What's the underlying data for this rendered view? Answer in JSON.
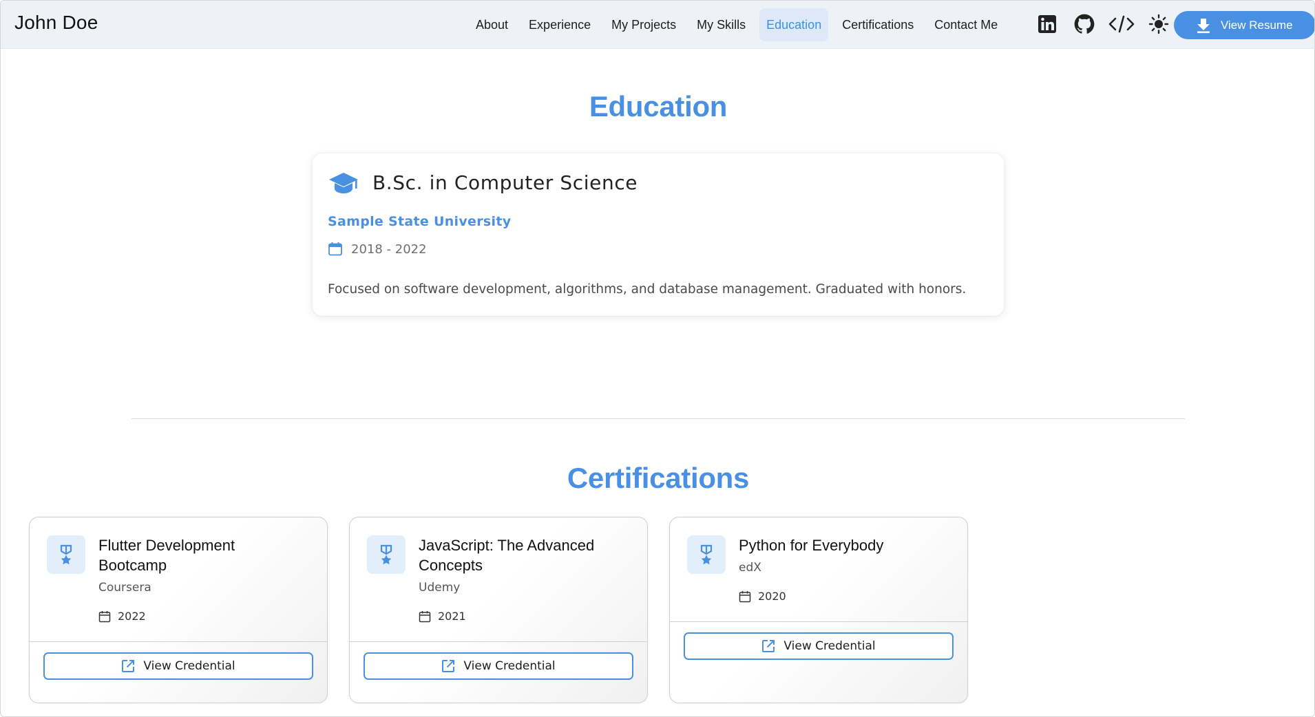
{
  "header": {
    "brand": "John Doe",
    "nav": [
      {
        "label": "About",
        "active": false
      },
      {
        "label": "Experience",
        "active": false
      },
      {
        "label": "My Projects",
        "active": false
      },
      {
        "label": "My Skills",
        "active": false
      },
      {
        "label": "Education",
        "active": true
      },
      {
        "label": "Certifications",
        "active": false
      },
      {
        "label": "Contact Me",
        "active": false
      }
    ],
    "icons": [
      "linkedin-icon",
      "github-icon",
      "code-icon",
      "sun-icon"
    ],
    "resume_button": "View Resume"
  },
  "education": {
    "title": "Education",
    "degree": "B.Sc. in Computer Science",
    "school": "Sample State University",
    "dates": "2018 - 2022",
    "description": "Focused on software development, algorithms, and database management. Graduated with honors."
  },
  "certifications": {
    "title": "Certifications",
    "items": [
      {
        "name": "Flutter Development Bootcamp",
        "issuer": "Coursera",
        "year": "2022",
        "button": "View Credential"
      },
      {
        "name": "JavaScript: The Advanced Concepts",
        "issuer": "Udemy",
        "year": "2021",
        "button": "View Credential"
      },
      {
        "name": "Python for Everybody",
        "issuer": "edX",
        "year": "2020",
        "button": "View Credential"
      }
    ]
  },
  "colors": {
    "accent": "#4a90e2",
    "nav_bg": "#eef1f6",
    "active_nav_bg": "#dde9f7",
    "badge_bg": "#e3eefb"
  }
}
